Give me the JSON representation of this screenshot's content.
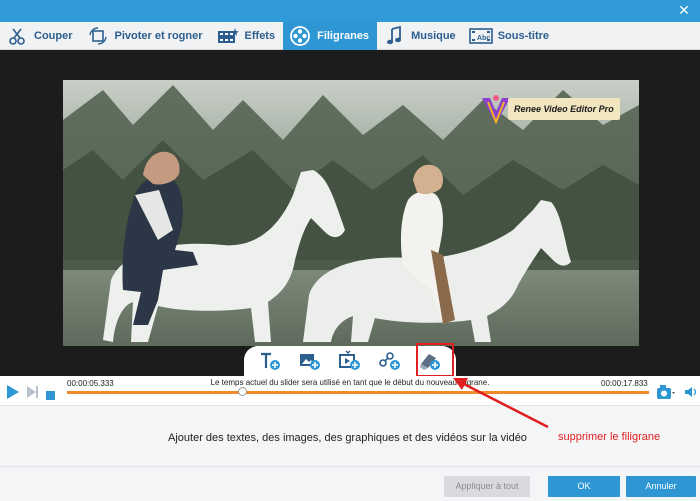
{
  "window": {
    "close_glyph": "✕"
  },
  "tabs": [
    {
      "label": "Couper",
      "icon": "cut-icon"
    },
    {
      "label": "Pivoter et rogner",
      "icon": "rotate-crop-icon"
    },
    {
      "label": "Effets",
      "icon": "effects-icon"
    },
    {
      "label": "Filigranes",
      "icon": "watermark-icon",
      "active": true
    },
    {
      "label": "Musique",
      "icon": "music-icon"
    },
    {
      "label": "Sous-titre",
      "icon": "subtitle-icon"
    }
  ],
  "watermark": {
    "label": "Renee Video Editor Pro"
  },
  "watermark_tools": [
    {
      "name": "add-text-icon"
    },
    {
      "name": "add-image-icon"
    },
    {
      "name": "add-video-icon"
    },
    {
      "name": "add-graphic-icon"
    },
    {
      "name": "remove-watermark-icon"
    }
  ],
  "playback": {
    "current_time": "00:00:05.333",
    "end_time": "00:00:17.833",
    "hint": "Le temps actuel du slider sera utilisé en tant que le début du nouveau filigrane.",
    "position": 0.3
  },
  "description": "Ajouter des textes, des images, des graphiques et des vidéos sur la vidéo",
  "annotation": "supprimer le filigrane",
  "buttons": {
    "apply_all": "Appliquer à tout",
    "ok": "OK",
    "cancel": "Annuler"
  },
  "colors": {
    "accent": "#2e97d3",
    "highlight": "#e02020",
    "progress": "#f08a2a"
  }
}
